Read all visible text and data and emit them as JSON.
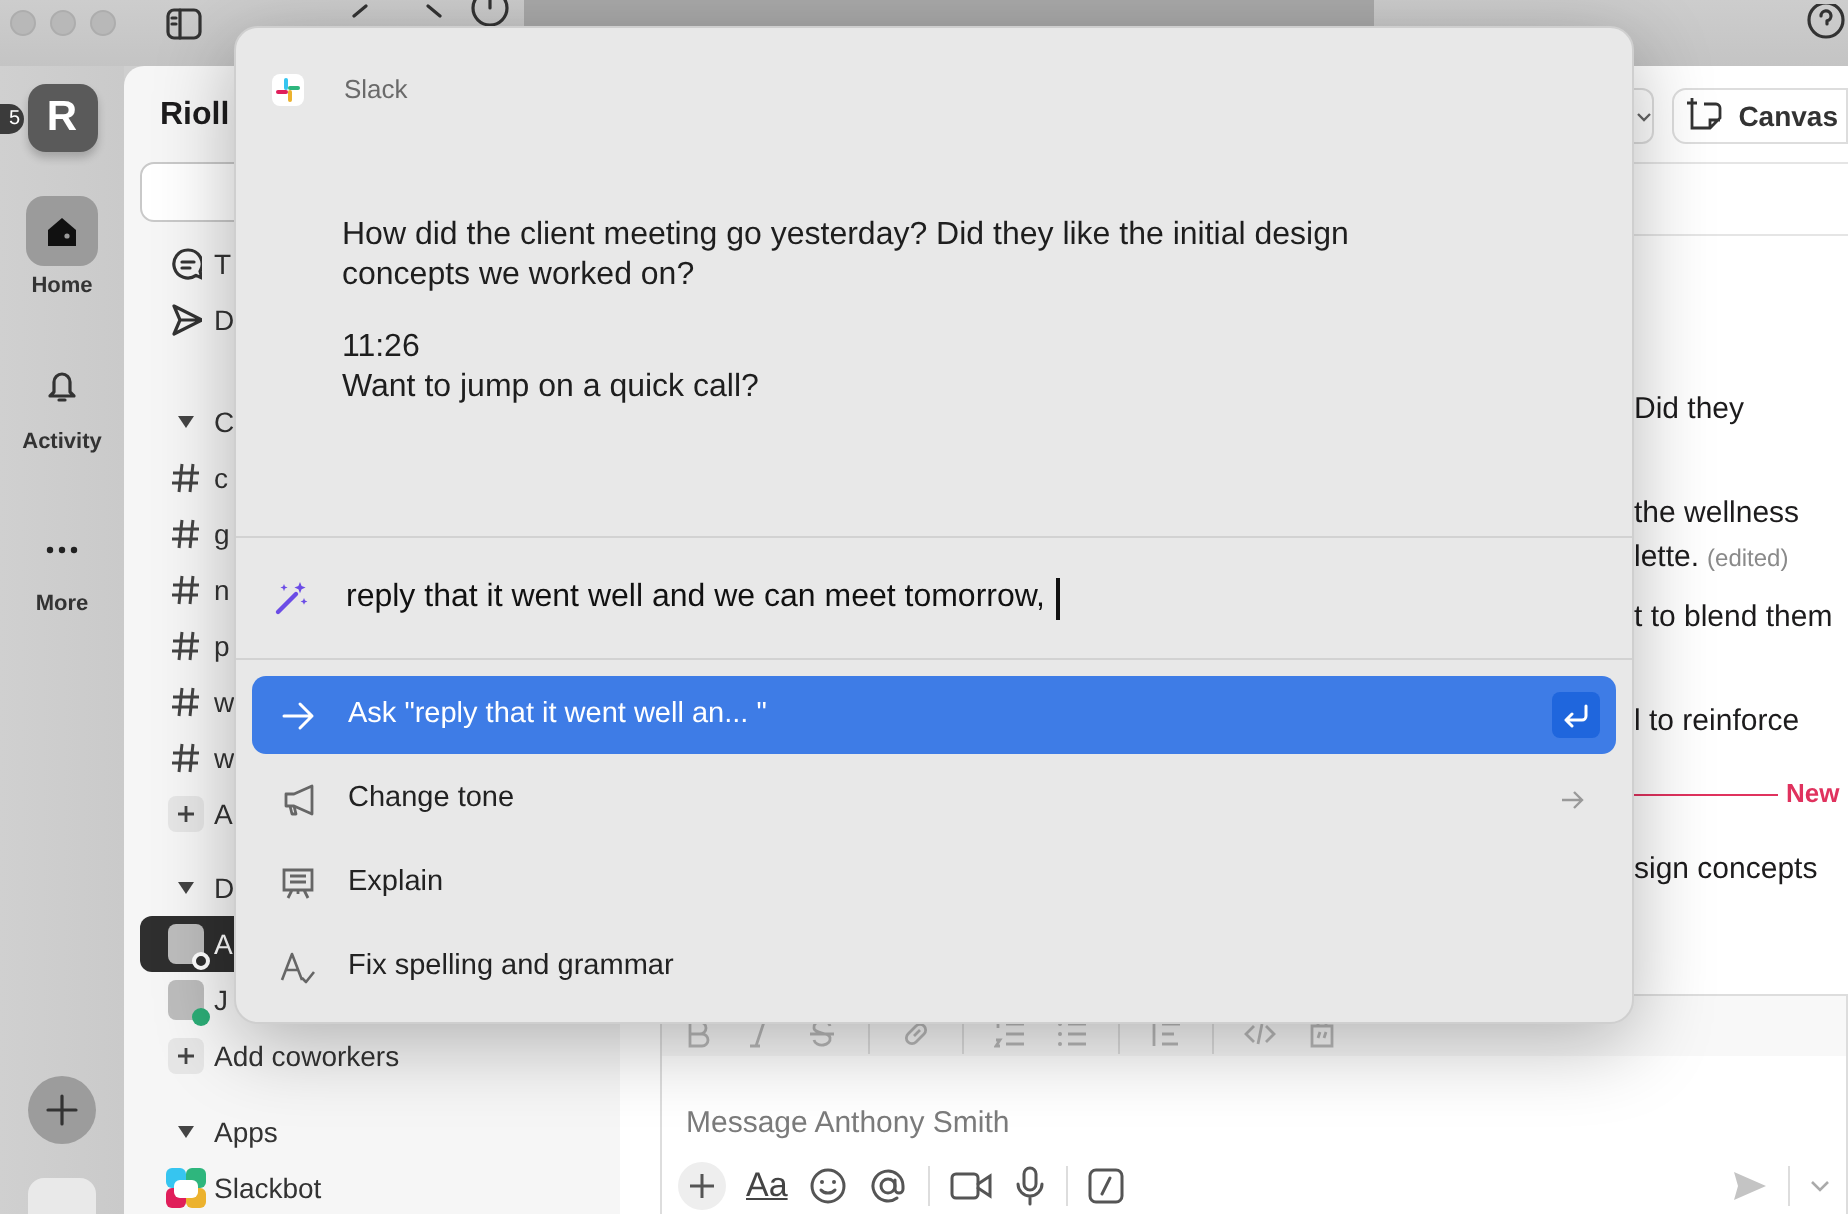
{
  "rail": {
    "workspace": {
      "initial": "R",
      "badge": "5"
    },
    "items": [
      {
        "label": "Home",
        "selected": true
      },
      {
        "label": "Activity",
        "selected": false
      },
      {
        "label": "More",
        "selected": false
      }
    ]
  },
  "sidebar": {
    "workspace_name": "Rioll",
    "rows": [
      {
        "kind": "nav",
        "label": "T"
      },
      {
        "kind": "nav",
        "label": "D"
      },
      {
        "kind": "section",
        "label": "C",
        "expanded": true
      },
      {
        "kind": "channel",
        "label": "c"
      },
      {
        "kind": "channel",
        "label": "g"
      },
      {
        "kind": "channel",
        "label": "n"
      },
      {
        "kind": "channel",
        "label": "p"
      },
      {
        "kind": "channel",
        "label": "w"
      },
      {
        "kind": "channel",
        "label": "w"
      },
      {
        "kind": "add",
        "label": "A"
      },
      {
        "kind": "section",
        "label": "D",
        "expanded": true
      },
      {
        "kind": "dm",
        "label": "A",
        "selected": true,
        "online": false
      },
      {
        "kind": "dm",
        "label": "J",
        "selected": false,
        "online": true
      },
      {
        "kind": "add",
        "label": "Add coworkers"
      },
      {
        "kind": "section",
        "label": "Apps",
        "expanded": true
      },
      {
        "kind": "app",
        "label": "Slackbot"
      }
    ]
  },
  "main": {
    "canvas_button": "Canvas",
    "messages": [
      {
        "kind": "text",
        "lines": [
          "Did they"
        ]
      },
      {
        "kind": "text",
        "lines": [
          "the wellness",
          "lette."
        ],
        "edited": "(edited)"
      },
      {
        "kind": "text",
        "lines": [
          "t to blend them"
        ]
      },
      {
        "kind": "text",
        "lines": [
          "l to reinforce"
        ]
      },
      {
        "kind": "divider",
        "label": "New"
      },
      {
        "kind": "text",
        "lines": [
          "sign concepts"
        ]
      }
    ],
    "composer": {
      "placeholder": "Message Anthony Smith",
      "format_button": "Aa"
    }
  },
  "popup": {
    "app": "Slack",
    "context": [
      {
        "lines": [
          "How did the client meeting go yesterday? Did they like the initial design",
          "concepts we worked on?"
        ]
      },
      {
        "lines": [
          "11:26",
          "Want to jump on a quick call?"
        ]
      }
    ],
    "prompt": {
      "value": "reply that it went well and we can meet tomorrow,"
    },
    "actions": [
      {
        "kind": "ask",
        "label": "Ask \"reply that it went well an... \"",
        "selected": true
      },
      {
        "kind": "submenu",
        "label": "Change tone",
        "selected": false
      },
      {
        "kind": "action",
        "label": "Explain",
        "selected": false
      },
      {
        "kind": "action",
        "label": "Fix spelling and grammar",
        "selected": false
      }
    ]
  }
}
